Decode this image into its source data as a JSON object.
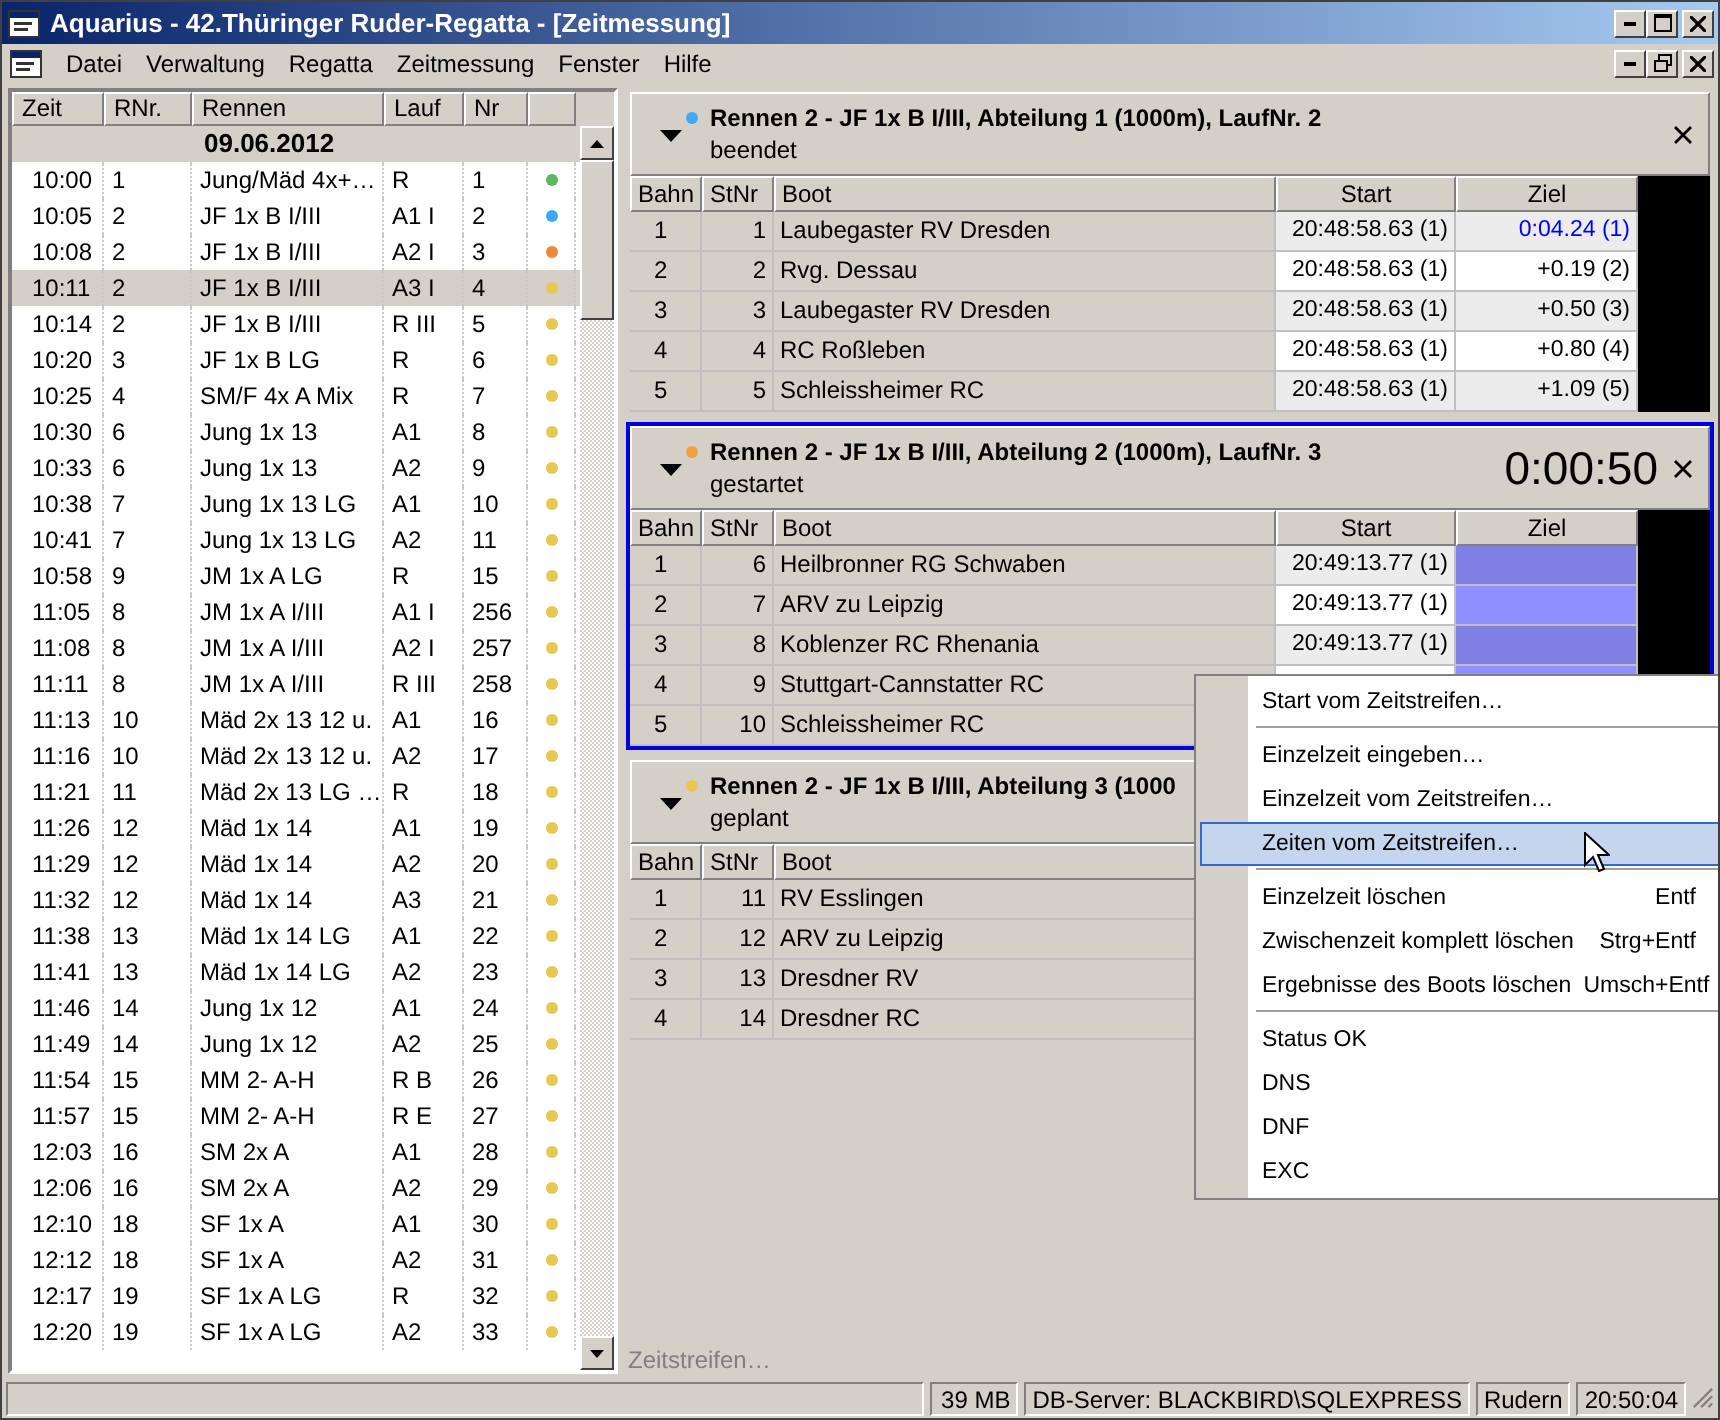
{
  "window": {
    "title": "Aquarius - 42.Thüringer Ruder-Regatta - [Zeitmessung]"
  },
  "menu": [
    "Datei",
    "Verwaltung",
    "Regatta",
    "Zeitmessung",
    "Fenster",
    "Hilfe"
  ],
  "schedule": {
    "columns": [
      "Zeit",
      "RNr.",
      "Rennen",
      "Lauf",
      "Nr"
    ],
    "date": "09.06.2012",
    "rows": [
      {
        "zeit": "10:00",
        "rnr": "1",
        "rennen": "Jung/Mäd 4x+…",
        "lauf": "R",
        "nr": "1",
        "color": "#5cb85c",
        "selected": false
      },
      {
        "zeit": "10:05",
        "rnr": "2",
        "rennen": "JF 1x B I/III",
        "lauf": "A1 I",
        "nr": "2",
        "color": "#3fa9f5",
        "selected": false
      },
      {
        "zeit": "10:08",
        "rnr": "2",
        "rennen": "JF 1x B I/III",
        "lauf": "A2 I",
        "nr": "3",
        "color": "#f0883a",
        "selected": false
      },
      {
        "zeit": "10:11",
        "rnr": "2",
        "rennen": "JF 1x B I/III",
        "lauf": "A3 I",
        "nr": "4",
        "color": "#e8c850",
        "selected": true
      },
      {
        "zeit": "10:14",
        "rnr": "2",
        "rennen": "JF 1x B I/III",
        "lauf": "R III",
        "nr": "5",
        "color": "#e8c850",
        "selected": false
      },
      {
        "zeit": "10:20",
        "rnr": "3",
        "rennen": "JF 1x B LG",
        "lauf": "R",
        "nr": "6",
        "color": "#e8c850",
        "selected": false
      },
      {
        "zeit": "10:25",
        "rnr": "4",
        "rennen": "SM/F 4x A Mix",
        "lauf": "R",
        "nr": "7",
        "color": "#e8c850",
        "selected": false
      },
      {
        "zeit": "10:30",
        "rnr": "6",
        "rennen": "Jung 1x 13",
        "lauf": "A1",
        "nr": "8",
        "color": "#e8c850",
        "selected": false
      },
      {
        "zeit": "10:33",
        "rnr": "6",
        "rennen": "Jung 1x 13",
        "lauf": "A2",
        "nr": "9",
        "color": "#e8c850",
        "selected": false
      },
      {
        "zeit": "10:38",
        "rnr": "7",
        "rennen": "Jung 1x 13 LG",
        "lauf": "A1",
        "nr": "10",
        "color": "#e8c850",
        "selected": false
      },
      {
        "zeit": "10:41",
        "rnr": "7",
        "rennen": "Jung 1x 13 LG",
        "lauf": "A2",
        "nr": "11",
        "color": "#e8c850",
        "selected": false
      },
      {
        "zeit": "10:58",
        "rnr": "9",
        "rennen": "JM 1x A LG",
        "lauf": "R",
        "nr": "15",
        "color": "#e8c850",
        "selected": false
      },
      {
        "zeit": "11:05",
        "rnr": "8",
        "rennen": "JM 1x A I/III",
        "lauf": "A1 I",
        "nr": "256",
        "color": "#e8c850",
        "selected": false
      },
      {
        "zeit": "11:08",
        "rnr": "8",
        "rennen": "JM 1x A I/III",
        "lauf": "A2 I",
        "nr": "257",
        "color": "#e8c850",
        "selected": false
      },
      {
        "zeit": "11:11",
        "rnr": "8",
        "rennen": "JM 1x A I/III",
        "lauf": "R III",
        "nr": "258",
        "color": "#e8c850",
        "selected": false
      },
      {
        "zeit": "11:13",
        "rnr": "10",
        "rennen": "Mäd 2x 13 12 u.",
        "lauf": "A1",
        "nr": "16",
        "color": "#e8c850",
        "selected": false
      },
      {
        "zeit": "11:16",
        "rnr": "10",
        "rennen": "Mäd 2x 13 12 u.",
        "lauf": "A2",
        "nr": "17",
        "color": "#e8c850",
        "selected": false
      },
      {
        "zeit": "11:21",
        "rnr": "11",
        "rennen": "Mäd 2x 13 LG …",
        "lauf": "R",
        "nr": "18",
        "color": "#e8c850",
        "selected": false
      },
      {
        "zeit": "11:26",
        "rnr": "12",
        "rennen": "Mäd 1x 14",
        "lauf": "A1",
        "nr": "19",
        "color": "#e8c850",
        "selected": false
      },
      {
        "zeit": "11:29",
        "rnr": "12",
        "rennen": "Mäd 1x 14",
        "lauf": "A2",
        "nr": "20",
        "color": "#e8c850",
        "selected": false
      },
      {
        "zeit": "11:32",
        "rnr": "12",
        "rennen": "Mäd 1x 14",
        "lauf": "A3",
        "nr": "21",
        "color": "#e8c850",
        "selected": false
      },
      {
        "zeit": "11:38",
        "rnr": "13",
        "rennen": "Mäd 1x 14 LG",
        "lauf": "A1",
        "nr": "22",
        "color": "#e8c850",
        "selected": false
      },
      {
        "zeit": "11:41",
        "rnr": "13",
        "rennen": "Mäd 1x 14 LG",
        "lauf": "A2",
        "nr": "23",
        "color": "#e8c850",
        "selected": false
      },
      {
        "zeit": "11:46",
        "rnr": "14",
        "rennen": "Jung 1x 12",
        "lauf": "A1",
        "nr": "24",
        "color": "#e8c850",
        "selected": false
      },
      {
        "zeit": "11:49",
        "rnr": "14",
        "rennen": "Jung 1x 12",
        "lauf": "A2",
        "nr": "25",
        "color": "#e8c850",
        "selected": false
      },
      {
        "zeit": "11:54",
        "rnr": "15",
        "rennen": "MM 2- A-H",
        "lauf": "R B",
        "nr": "26",
        "color": "#e8c850",
        "selected": false
      },
      {
        "zeit": "11:57",
        "rnr": "15",
        "rennen": "MM 2- A-H",
        "lauf": "R E",
        "nr": "27",
        "color": "#e8c850",
        "selected": false
      },
      {
        "zeit": "12:03",
        "rnr": "16",
        "rennen": "SM 2x A",
        "lauf": "A1",
        "nr": "28",
        "color": "#e8c850",
        "selected": false
      },
      {
        "zeit": "12:06",
        "rnr": "16",
        "rennen": "SM 2x A",
        "lauf": "A2",
        "nr": "29",
        "color": "#e8c850",
        "selected": false
      },
      {
        "zeit": "12:10",
        "rnr": "18",
        "rennen": "SF 1x A",
        "lauf": "A1",
        "nr": "30",
        "color": "#e8c850",
        "selected": false
      },
      {
        "zeit": "12:12",
        "rnr": "18",
        "rennen": "SF 1x A",
        "lauf": "A2",
        "nr": "31",
        "color": "#e8c850",
        "selected": false
      },
      {
        "zeit": "12:17",
        "rnr": "19",
        "rennen": "SF 1x A LG",
        "lauf": "R",
        "nr": "32",
        "color": "#e8c850",
        "selected": false
      },
      {
        "zeit": "12:20",
        "rnr": "19",
        "rennen": "SF 1x A LG",
        "lauf": "A2",
        "nr": "33",
        "color": "#e8c850",
        "selected": false
      }
    ]
  },
  "races": [
    {
      "title": "Rennen 2 - JF 1x B I/III, Abteilung 1 (1000m), LaufNr. 2",
      "status": "beendet",
      "color": "#3fa9f5",
      "selected": false,
      "columns": [
        "Bahn",
        "StNr",
        "Boot",
        "Start",
        "Ziel"
      ],
      "rows": [
        {
          "bahn": "1",
          "stnr": "1",
          "boot": "Laubegaster RV Dresden",
          "start": "20:48:58.63 (1)",
          "ziel": "0:04.24 (1)",
          "kind": "leader"
        },
        {
          "bahn": "2",
          "stnr": "2",
          "boot": "Rvg. Dessau",
          "start": "20:48:58.63 (1)",
          "ziel": "+0.19 (2)",
          "kind": "time"
        },
        {
          "bahn": "3",
          "stnr": "3",
          "boot": "Laubegaster RV Dresden",
          "start": "20:48:58.63 (1)",
          "ziel": "+0.50 (3)",
          "kind": "time"
        },
        {
          "bahn": "4",
          "stnr": "4",
          "boot": "RC Roßleben",
          "start": "20:48:58.63 (1)",
          "ziel": "+0.80 (4)",
          "kind": "time"
        },
        {
          "bahn": "5",
          "stnr": "5",
          "boot": "Schleissheimer RC",
          "start": "20:48:58.63 (1)",
          "ziel": "+1.09 (5)",
          "kind": "time"
        }
      ]
    },
    {
      "title": "Rennen 2 - JF 1x B I/III, Abteilung 2 (1000m), LaufNr. 3",
      "status": "gestartet",
      "timer": "0:00:50",
      "color": "#f0a040",
      "selected": true,
      "columns": [
        "Bahn",
        "StNr",
        "Boot",
        "Start",
        "Ziel"
      ],
      "rows": [
        {
          "bahn": "1",
          "stnr": "6",
          "boot": "Heilbronner RG Schwaben",
          "start": "20:49:13.77 (1)",
          "kind": "pending"
        },
        {
          "bahn": "2",
          "stnr": "7",
          "boot": "ARV zu Leipzig",
          "start": "20:49:13.77 (1)",
          "kind": "pending"
        },
        {
          "bahn": "3",
          "stnr": "8",
          "boot": "Koblenzer RC Rhenania",
          "start": "20:49:13.77 (1)",
          "kind": "pending"
        },
        {
          "bahn": "4",
          "stnr": "9",
          "boot": "Stuttgart-Cannstatter RC",
          "kind": "pending"
        },
        {
          "bahn": "5",
          "stnr": "10",
          "boot": "Schleissheimer RC",
          "kind": "empty"
        }
      ]
    },
    {
      "title": "Rennen 2 - JF 1x B I/III, Abteilung 3 (1000",
      "status": "geplant",
      "color": "#e8c850",
      "selected": false,
      "columns": [
        "Bahn",
        "StNr",
        "Boot"
      ],
      "rows": [
        {
          "bahn": "1",
          "stnr": "11",
          "boot": "RV Esslingen",
          "kind": "empty"
        },
        {
          "bahn": "2",
          "stnr": "12",
          "boot": "ARV zu Leipzig",
          "kind": "empty"
        },
        {
          "bahn": "3",
          "stnr": "13",
          "boot": "Dresdner RV",
          "kind": "empty"
        },
        {
          "bahn": "4",
          "stnr": "14",
          "boot": "Dresdner RC",
          "kind": "empty"
        }
      ]
    }
  ],
  "timestrip_hint": "Zeitstreifen…",
  "context_menu": [
    {
      "kind": "item",
      "label": "Start vom Zeitstreifen…",
      "selected": false
    },
    {
      "kind": "separator"
    },
    {
      "kind": "item",
      "label": "Einzelzeit eingeben…",
      "selected": false
    },
    {
      "kind": "item",
      "label": "Einzelzeit vom Zeitstreifen…",
      "selected": false
    },
    {
      "kind": "item",
      "label": "Zeiten vom Zeitstreifen…",
      "selected": true
    },
    {
      "kind": "separator"
    },
    {
      "kind": "item",
      "label": "Einzelzeit löschen",
      "shortcut": "Entf",
      "selected": false
    },
    {
      "kind": "item",
      "label": "Zwischenzeit komplett löschen",
      "shortcut": "Strg+Entf",
      "selected": false
    },
    {
      "kind": "item",
      "label": "Ergebnisse des Boots löschen",
      "shortcut": "Umsch+Entf",
      "selected": false
    },
    {
      "kind": "separator"
    },
    {
      "kind": "item",
      "label": "Status OK",
      "selected": false
    },
    {
      "kind": "item",
      "label": "DNS",
      "selected": false
    },
    {
      "kind": "item",
      "label": "DNF",
      "selected": false
    },
    {
      "kind": "item",
      "label": "EXC",
      "selected": false
    }
  ],
  "status_bar": [
    "39 MB",
    "DB-Server: BLACKBIRD\\SQLEXPRESS",
    "Rudern",
    "20:50:04"
  ]
}
